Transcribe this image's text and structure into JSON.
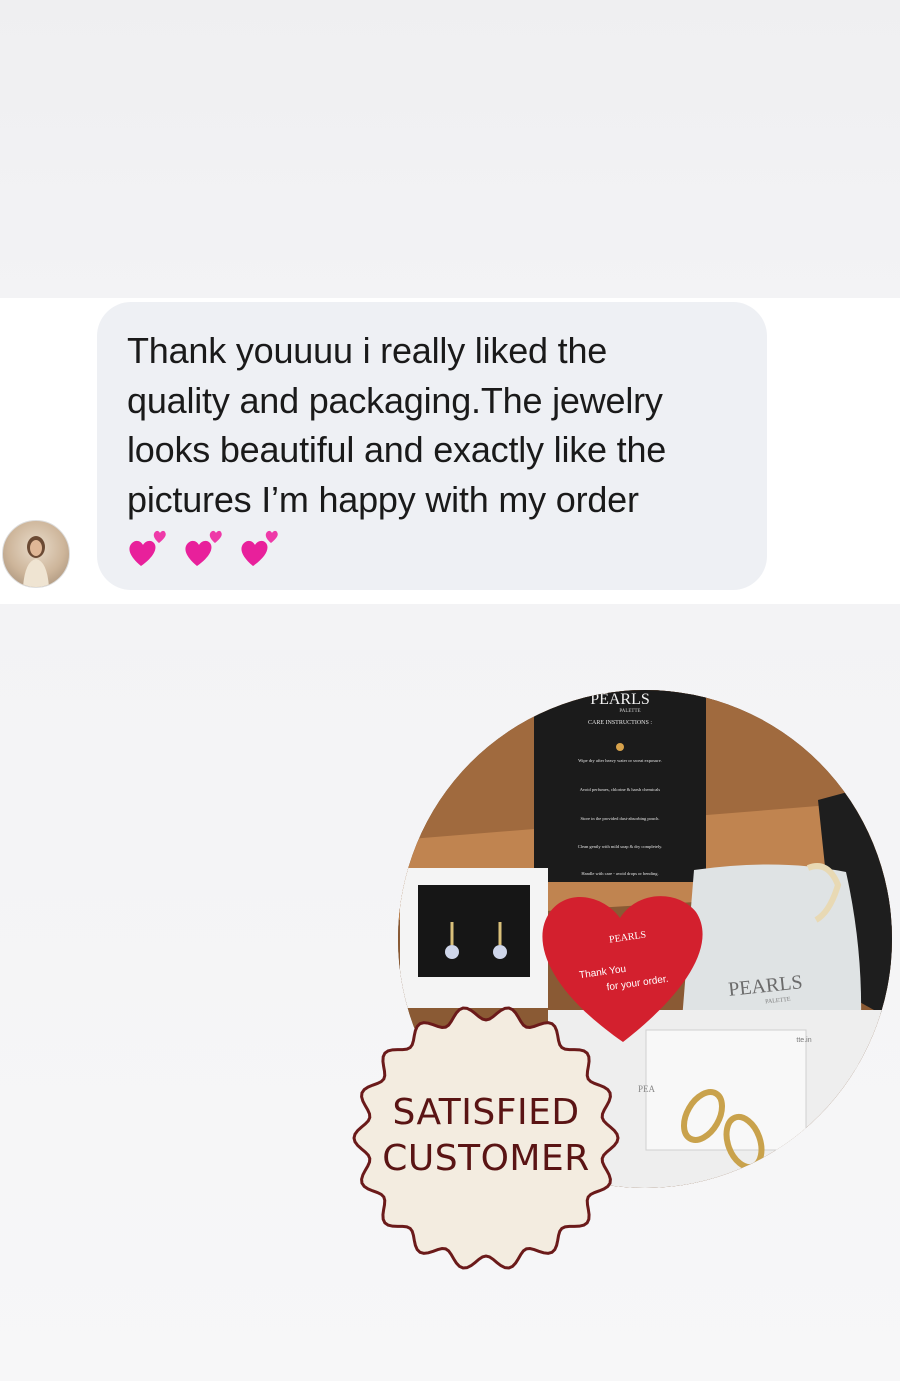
{
  "message": {
    "text_lines": [
      "Thank youuuu i really liked the",
      "quality and packaging.The jewelry",
      "looks beautiful and exactly like the",
      "pictures I’m happy with my order"
    ],
    "emoji": [
      "💕",
      "💕",
      "💕"
    ],
    "bubble_color": "#eef0f4"
  },
  "photo": {
    "care_card": {
      "brand": "PEARLS",
      "brand_sub": "PALETTE",
      "heading": "CARE INSTRUCTIONS :",
      "items": [
        "Wipe dry after heavy water or sweat exposure.",
        "Avoid perfumes, chlorine & harsh chemicals",
        "Store in the provided dust-absorbing pouch.",
        "Clean gently with mild soap & dry completely.",
        "Handle with care - avoid drops or bending."
      ]
    },
    "heart_card": {
      "brand": "PEARLS",
      "line1": "Thank You",
      "line2": "for your order."
    },
    "pouch": {
      "brand": "PEARLS",
      "brand_sub": "PALETTE",
      "url_fragment": "tte.in"
    },
    "box_label": "PEA"
  },
  "badge": {
    "line1": "SATISFIED",
    "line2": "CUSTOMER"
  },
  "colors": {
    "heart_card": "#d3202e",
    "badge_fill": "#f3ece0",
    "badge_text": "#5a1414"
  }
}
